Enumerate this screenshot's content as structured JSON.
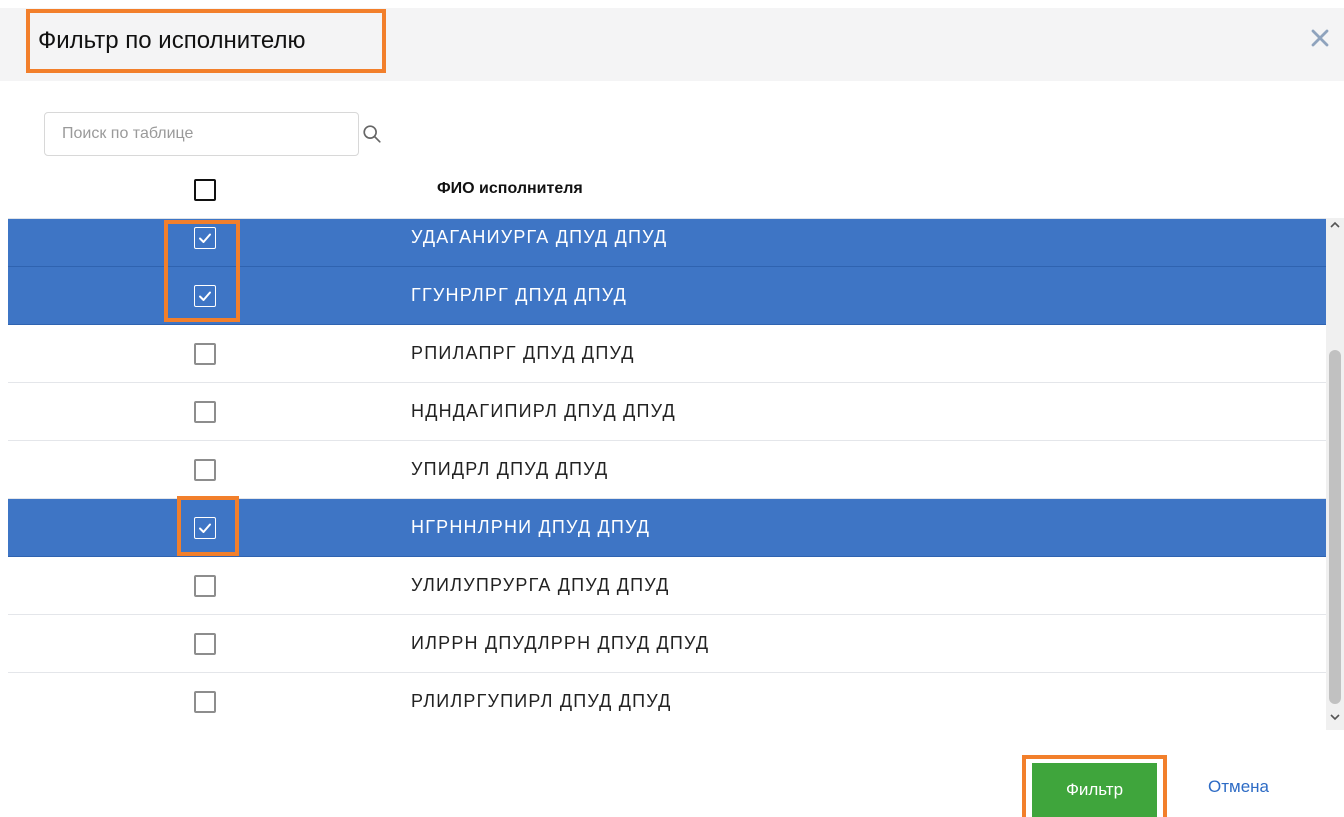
{
  "dialog": {
    "title": "Фильтр по исполнителю",
    "close_icon": "close-icon"
  },
  "search": {
    "placeholder": "Поиск по таблице",
    "value": "",
    "icon": "search-icon"
  },
  "table": {
    "header": {
      "column_label": "ФИО исполнителя",
      "select_all_checked": false
    },
    "rows": [
      {
        "name": "УДАГАНИУРГА ДПУД ДПУД",
        "checked": true
      },
      {
        "name": "ГГУНРЛРГ ДПУД ДПУД",
        "checked": true
      },
      {
        "name": "РПИЛАПРГ ДПУД ДПУД",
        "checked": false
      },
      {
        "name": "НДНДАГИПИРЛ ДПУД ДПУД",
        "checked": false
      },
      {
        "name": "УПИДРЛ ДПУД ДПУД",
        "checked": false
      },
      {
        "name": "НГРННЛРНИ ДПУД ДПУД",
        "checked": true
      },
      {
        "name": "УЛИЛУПРУРГА ДПУД ДПУД",
        "checked": false
      },
      {
        "name": "ИЛРРН ДПУДЛРРН ДПУД ДПУД",
        "checked": false
      },
      {
        "name": "РЛИЛРГУПИРЛ ДПУД ДПУД",
        "checked": false
      }
    ]
  },
  "actions": {
    "filter_label": "Фильтр",
    "cancel_label": "Отмена"
  },
  "colors": {
    "selected_row": "#3e75c5",
    "filter_button": "#3fa53c",
    "highlight": "#f27f2b",
    "link": "#2d6bc5"
  }
}
